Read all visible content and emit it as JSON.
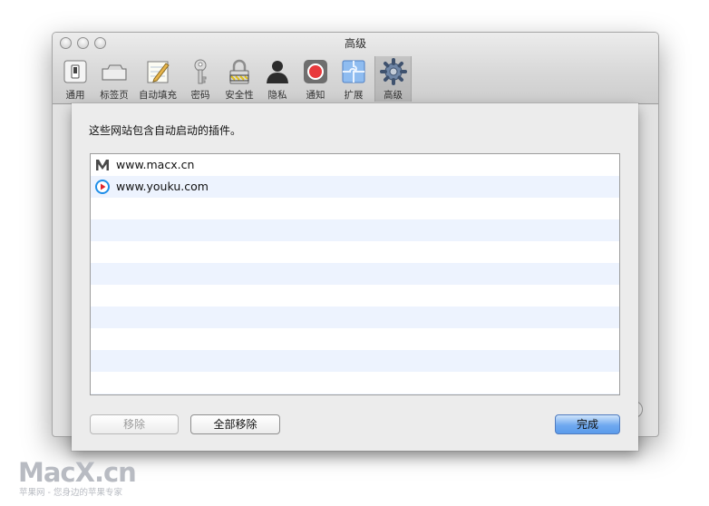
{
  "window": {
    "title": "高级"
  },
  "toolbar": {
    "items": [
      {
        "label": "通用",
        "icon": "light-switch-icon"
      },
      {
        "label": "标签页",
        "icon": "tab-icon"
      },
      {
        "label": "自动填充",
        "icon": "notepad-pencil-icon"
      },
      {
        "label": "密码",
        "icon": "key-icon"
      },
      {
        "label": "安全性",
        "icon": "padlock-icon"
      },
      {
        "label": "隐私",
        "icon": "silhouette-icon"
      },
      {
        "label": "通知",
        "icon": "notification-icon"
      },
      {
        "label": "扩展",
        "icon": "puzzle-icon"
      },
      {
        "label": "高级",
        "icon": "gear-icon",
        "selected": true
      }
    ]
  },
  "sheet": {
    "message": "这些网站包含自动启动的插件。",
    "sites": [
      {
        "name": "www.macx.cn",
        "icon": "macx-favicon"
      },
      {
        "name": "www.youku.com",
        "icon": "youku-favicon"
      }
    ],
    "remove_label": "移除",
    "remove_all_label": "全部移除",
    "done_label": "完成"
  },
  "help": {
    "label": "?"
  },
  "watermark": {
    "brand": "MacX.cn",
    "tagline": "苹果网 - 您身边的苹果专家"
  },
  "colors": {
    "accent": "#5b9bea",
    "stripe": "#edf3fe",
    "chrome": "#d7d7d7"
  }
}
